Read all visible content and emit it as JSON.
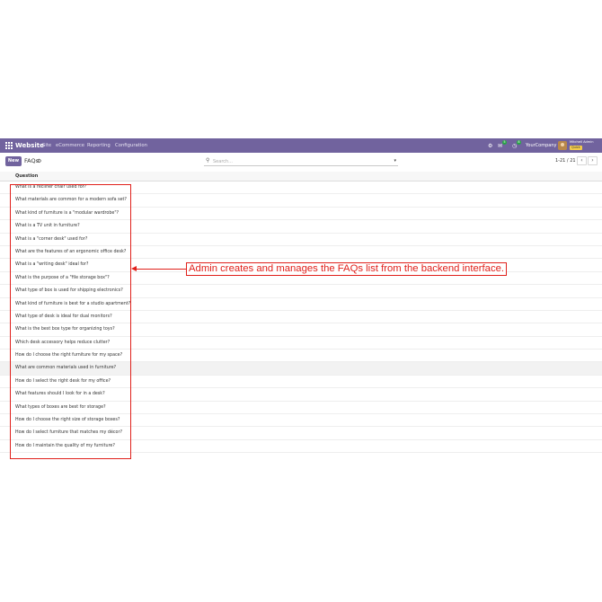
{
  "navbar": {
    "brand": "Website",
    "menu": [
      "Site",
      "eCommerce",
      "Reporting",
      "Configuration"
    ],
    "message_count": "5",
    "activity_count": "8",
    "company": "YourCompany",
    "user_name": "Mitchell Admin",
    "database": "Quick"
  },
  "control_panel": {
    "new_label": "New",
    "breadcrumb": "FAQs",
    "search_placeholder": "Search...",
    "pager": "1-21 / 21"
  },
  "list": {
    "column_header": "Question",
    "rows": [
      "What is a recliner chair used for?",
      "What materials are common for a modern sofa set?",
      "What kind of furniture is a \"modular wardrobe\"?",
      "What is a TV unit in furniture?",
      "What is a \"corner desk\" used for?",
      "What are the features of an ergonomic office desk?",
      "What is a \"writing desk\" ideal for?",
      "What is the purpose of a \"file storage box\"?",
      "What type of box is used for shipping electronics?",
      "What kind of furniture is best for a studio apartment?",
      "What type of desk is ideal for dual monitors?",
      "What is the best box type for organizing toys?",
      "Which desk accessory helps reduce clutter?",
      "How do I choose the right furniture for my space?",
      "What are common materials used in furniture?",
      "How do I select the right desk for my office?",
      "What features should I look for in a desk?",
      "What types of boxes are best for storage?",
      "How do I choose the right size of storage boxes?",
      "How do I select furniture that matches my décor?",
      "How do I maintain the quality of my furniture?"
    ]
  },
  "annotation": {
    "text": "Admin creates and manages the FAQs list from the backend interface."
  },
  "colors": {
    "navbar": "#71639e",
    "annotation": "#e0201b",
    "hover_row": "#f2f2f2"
  }
}
